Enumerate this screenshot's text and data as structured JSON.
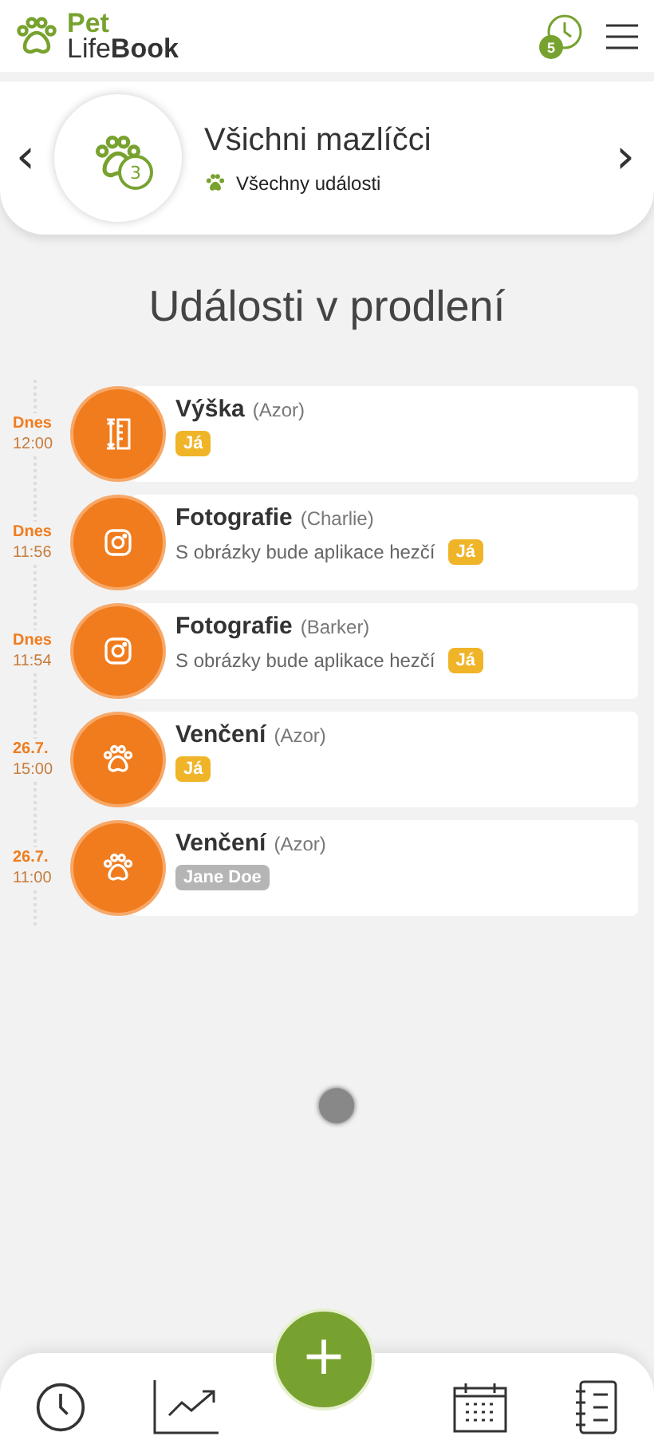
{
  "header": {
    "logo_top": "Pet",
    "logo_light": "Life",
    "logo_bold": "Book",
    "history_badge": "5"
  },
  "pet_selector": {
    "count": "3",
    "title": "Všichni mazlíčci",
    "subtitle": "Všechny události",
    "prev": "‹",
    "next": "›"
  },
  "section_title": "Události v prodlení",
  "events": [
    {
      "day": "Dnes",
      "time": "12:00",
      "kind": "ruler",
      "title": "Výška",
      "pet": "(Azor)",
      "assignee": {
        "label": "Já",
        "kind": "self"
      }
    },
    {
      "day": "Dnes",
      "time": "11:56",
      "kind": "camera",
      "title": "Fotografie",
      "pet": "(Charlie)",
      "note": "S obrázky bude aplikace hezčí",
      "assignee": {
        "label": "Já",
        "kind": "self"
      }
    },
    {
      "day": "Dnes",
      "time": "11:54",
      "kind": "camera",
      "title": "Fotografie",
      "pet": "(Barker)",
      "note": "S obrázky bude aplikace hezčí",
      "assignee": {
        "label": "Já",
        "kind": "self"
      }
    },
    {
      "day": "26.7.",
      "time": "15:00",
      "kind": "paw",
      "title": "Venčení",
      "pet": "(Azor)",
      "assignee": {
        "label": "Já",
        "kind": "self"
      }
    },
    {
      "day": "26.7.",
      "time": "11:00",
      "kind": "paw",
      "title": "Venčení",
      "pet": "(Azor)",
      "assignee": {
        "label": "Jane Doe",
        "kind": "other"
      }
    }
  ],
  "add_button": "+"
}
